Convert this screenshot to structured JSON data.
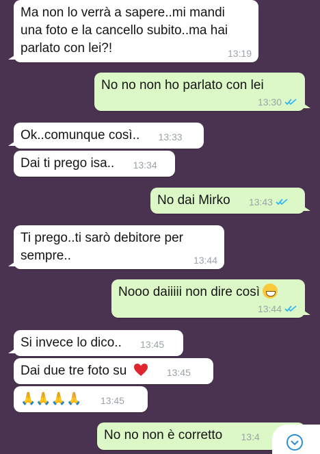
{
  "messages": [
    {
      "dir": "in",
      "text": "Ma non lo verrà a sapere..mi mandi\nuna foto e la cancello subito..ma hai\nparlato con lei?!",
      "time": "13:19"
    },
    {
      "dir": "out",
      "text": "No no non ho parlato con lei",
      "time": "13:30",
      "read": true
    },
    {
      "dir": "in",
      "text": "Ok..comunque così..",
      "time": "13:33"
    },
    {
      "dir": "in",
      "text": "Dai ti prego isa..",
      "time": "13:34"
    },
    {
      "dir": "out",
      "text": "No dai Mirko",
      "time": "13:43",
      "read": true
    },
    {
      "dir": "in",
      "text": "Ti prego..ti sarò debitore per\nsempre..",
      "time": "13:44"
    },
    {
      "dir": "out",
      "text": "Nooo daiiiii non dire così",
      "time": "13:44",
      "read": true,
      "emoji": "grinning-face-icon"
    },
    {
      "dir": "in",
      "text": "Si invece lo dico..",
      "time": "13:45"
    },
    {
      "dir": "in",
      "text": "Dai due tre foto su",
      "time": "13:45",
      "emoji": "red-heart-icon"
    },
    {
      "dir": "in",
      "text": "🙏🙏🙏🙏",
      "time": "13:45"
    },
    {
      "dir": "out",
      "text": "No no non è corretto",
      "time": "13:4"
    }
  ],
  "colors": {
    "background": "#4a3350",
    "incoming": "#ffffff",
    "outgoing": "#dcf8c6",
    "read_ticks": "#34b7f1"
  },
  "scroll_button": {
    "icon": "chevron-down-icon"
  }
}
